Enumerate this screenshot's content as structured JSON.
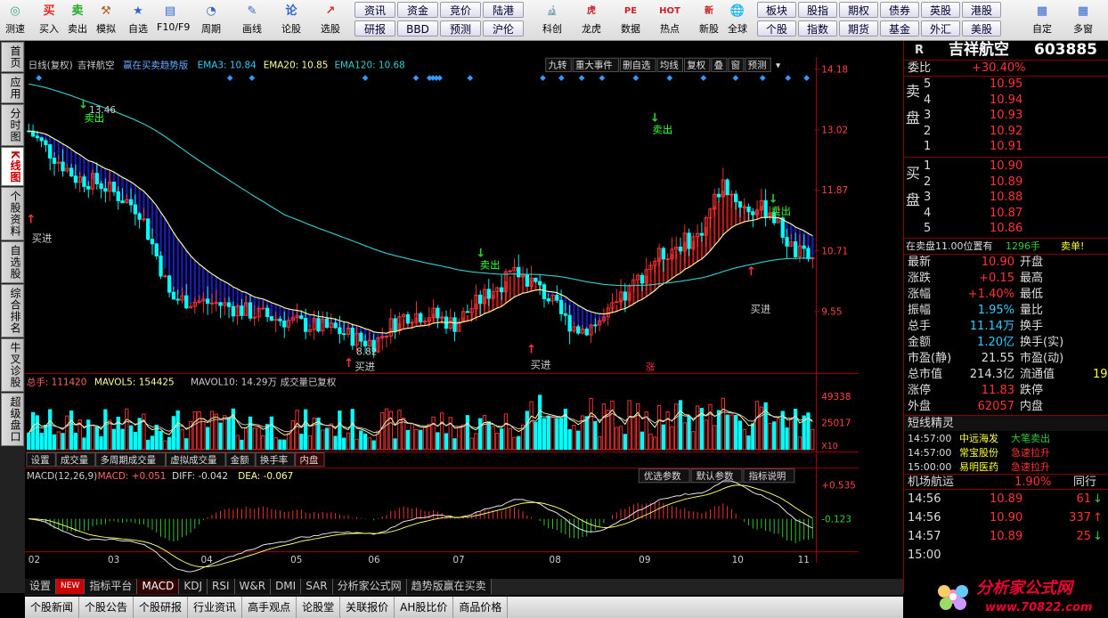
{
  "toolbar": {
    "left": [
      {
        "label": "测速",
        "icon": "gauge-icon",
        "color": "#3a7"
      },
      {
        "label": "买入",
        "icon": "buy-icon",
        "glyph": "买",
        "color": "#e22"
      },
      {
        "label": "卖出",
        "icon": "sell-icon",
        "glyph": "卖",
        "color": "#2a2"
      },
      {
        "label": "模拟",
        "icon": "hammer-icon",
        "glyph": "⚒",
        "color": "#a62"
      },
      {
        "label": "自选",
        "icon": "star-icon",
        "glyph": "★",
        "color": "#36c"
      },
      {
        "label": "F10/F9",
        "icon": "f10-icon",
        "glyph": "▤",
        "color": "#36c"
      },
      {
        "label": "周期",
        "icon": "clock-icon",
        "glyph": "◔",
        "color": "#36c"
      },
      {
        "label": "画线",
        "icon": "pencil-icon",
        "glyph": "✎",
        "color": "#36c"
      },
      {
        "label": "论股",
        "icon": "discuss-icon",
        "glyph": "论",
        "color": "#36c"
      },
      {
        "label": "选股",
        "icon": "chart-select-icon",
        "glyph": "↗",
        "color": "#c33"
      }
    ],
    "grid1": [
      "资讯",
      "资金",
      "竞价",
      "陆港"
    ],
    "grid2": [
      "研报",
      "BBD",
      "预测",
      "沪伦"
    ],
    "mid": [
      {
        "label": "科创",
        "glyph": "🔬"
      },
      {
        "label": "龙虎",
        "glyph": "虎"
      },
      {
        "label": "数据",
        "glyph": "PE"
      },
      {
        "label": "热点",
        "glyph": "HOT"
      },
      {
        "label": "新股",
        "glyph": "新"
      }
    ],
    "grid3": [
      "板块",
      "股指",
      "期权",
      "债券",
      "英股",
      "港股"
    ],
    "grid4": [
      "个股",
      "指数",
      "期货",
      "基金",
      "外汇",
      "美股"
    ],
    "right": [
      {
        "label": "全球",
        "glyph": "🌐"
      },
      {
        "label": "自定"
      },
      {
        "label": "多窗"
      }
    ]
  },
  "lefttabs": [
    "首页",
    "应用",
    "分时图",
    "K线图",
    "个股资料",
    "自选股",
    "综合排名",
    "牛叉诊股",
    "超级盘口"
  ],
  "chart_header": {
    "period": "日线(复权)",
    "name": "吉祥航空",
    "indicator": "赢在买卖趋势版",
    "ema3": "EMA3: 10.84",
    "ema20": "EMA20: 10.85",
    "ema120": "EMA120: 10.68"
  },
  "chart_tools": [
    "九转",
    "重大事件",
    "删自选",
    "均线",
    "复权",
    "叠",
    "窗",
    "预测"
  ],
  "price_axis": [
    "14.18",
    "13.02",
    "11.87",
    "10.71",
    "9.55"
  ],
  "price_annotations": {
    "high": "13.46",
    "low": "8.82",
    "sell": "卖出",
    "buy": "买进",
    "zhang": "涨"
  },
  "volume_header": {
    "total": "总手: 111420",
    "mavol5": "MAVOL5: 154425",
    "mavol10": "MAVOL10: 14.29万",
    "note": "成交量已复权"
  },
  "volume_axis": [
    "49338",
    "25017",
    "X10"
  ],
  "indicator_tabs": [
    "设置",
    "成交量",
    "多周期成交量",
    "虚拟成交量",
    "金额",
    "换手率",
    "内盘"
  ],
  "macd_header": {
    "name": "MACD(12,26,9)",
    "macd": "MACD: +0.051",
    "diff": "DIFF: -0.042",
    "dea": "DEA: -0.067"
  },
  "macd_buttons": [
    "优选参数",
    "默认参数",
    "指标说明"
  ],
  "macd_axis": [
    "+0.535",
    "-0.123"
  ],
  "months": [
    "02",
    "03",
    "04",
    "05",
    "06",
    "07",
    "08",
    "09",
    "10",
    "11"
  ],
  "bottom_tabs": [
    "设置",
    "NEW",
    "指标平台",
    "MACD",
    "KDJ",
    "RSI",
    "W&R",
    "DMI",
    "SAR",
    "分析家公式网",
    "趋势版赢在买卖"
  ],
  "news_tabs": [
    "个股新闻",
    "个股公告",
    "个股研报",
    "行业资讯",
    "高手观点",
    "论股堂",
    "关联报价",
    "AH股比价",
    "商品价格"
  ],
  "quote": {
    "r_label": "R",
    "name": "吉祥航空",
    "code": "603885",
    "webi_label": "委比",
    "webi": "+30.40%",
    "sell_label": "卖盘",
    "buy_label": "买盘",
    "asks": [
      {
        "lvl": "5",
        "p": "10.95"
      },
      {
        "lvl": "4",
        "p": "10.94"
      },
      {
        "lvl": "3",
        "p": "10.93"
      },
      {
        "lvl": "2",
        "p": "10.92"
      },
      {
        "lvl": "1",
        "p": "10.91"
      }
    ],
    "bids": [
      {
        "lvl": "1",
        "p": "10.90"
      },
      {
        "lvl": "2",
        "p": "10.89"
      },
      {
        "lvl": "3",
        "p": "10.88"
      },
      {
        "lvl": "4",
        "p": "10.87"
      },
      {
        "lvl": "5",
        "p": "10.86"
      }
    ],
    "sell_position": "在卖盘11.00位置有",
    "sell_position_vol": "1296手",
    "sell_position_tag": "卖单!",
    "stats": [
      {
        "l": "最新",
        "v": "10.90",
        "c": "r",
        "l2": "开盘"
      },
      {
        "l": "涨跌",
        "v": "+0.15",
        "c": "r",
        "l2": "最高"
      },
      {
        "l": "涨幅",
        "v": "+1.40%",
        "c": "r",
        "l2": "最低"
      },
      {
        "l": "振幅",
        "v": "1.95%",
        "c": "c",
        "l2": "量比"
      },
      {
        "l": "总手",
        "v": "11.14万",
        "c": "c",
        "l2": "换手"
      },
      {
        "l": "金额",
        "v": "1.20亿",
        "c": "c",
        "l2": "换手(实)"
      },
      {
        "l": "市盈(静)",
        "v": "21.55",
        "c": "w",
        "l2": "市盈(动)"
      },
      {
        "l": "总市值",
        "v": "214.3亿",
        "c": "w",
        "l2": "流通值",
        "v2": "19"
      },
      {
        "l": "涨停",
        "v": "11.83",
        "c": "r",
        "l2": "跌停"
      },
      {
        "l": "外盘",
        "v": "62057",
        "c": "r",
        "l2": "内盘"
      }
    ],
    "short_title": "短线精灵",
    "alerts": [
      {
        "t": "14:57:00",
        "n": "中远海发",
        "e": "大笔卖出"
      },
      {
        "t": "14:57:00",
        "n": "常宝股份",
        "e": "急速拉升"
      },
      {
        "t": "15:00:00",
        "n": "易明医药",
        "e": "急速拉升"
      }
    ],
    "sector": "机场航运",
    "sector_pct": "1.90%",
    "sector_rank": "同行",
    "ticks": [
      {
        "t": "14:56",
        "p": "10.89",
        "v": "61"
      },
      {
        "t": "14:56",
        "p": "10.90",
        "v": "337"
      },
      {
        "t": "14:57",
        "p": "10.89",
        "v": "25"
      },
      {
        "t": "15:00",
        "p": "",
        "v": ""
      }
    ]
  },
  "watermark": {
    "title": "分析家公式网",
    "url": "www.70822.com"
  },
  "colors": {
    "up": "#ff3333",
    "down": "#00ffff",
    "ema20": "#ffff99",
    "ema120": "#33cccc",
    "fill_down": "#1a1ab0",
    "fill_up": "#b01a1a",
    "axis_red": "#aa0000"
  }
}
